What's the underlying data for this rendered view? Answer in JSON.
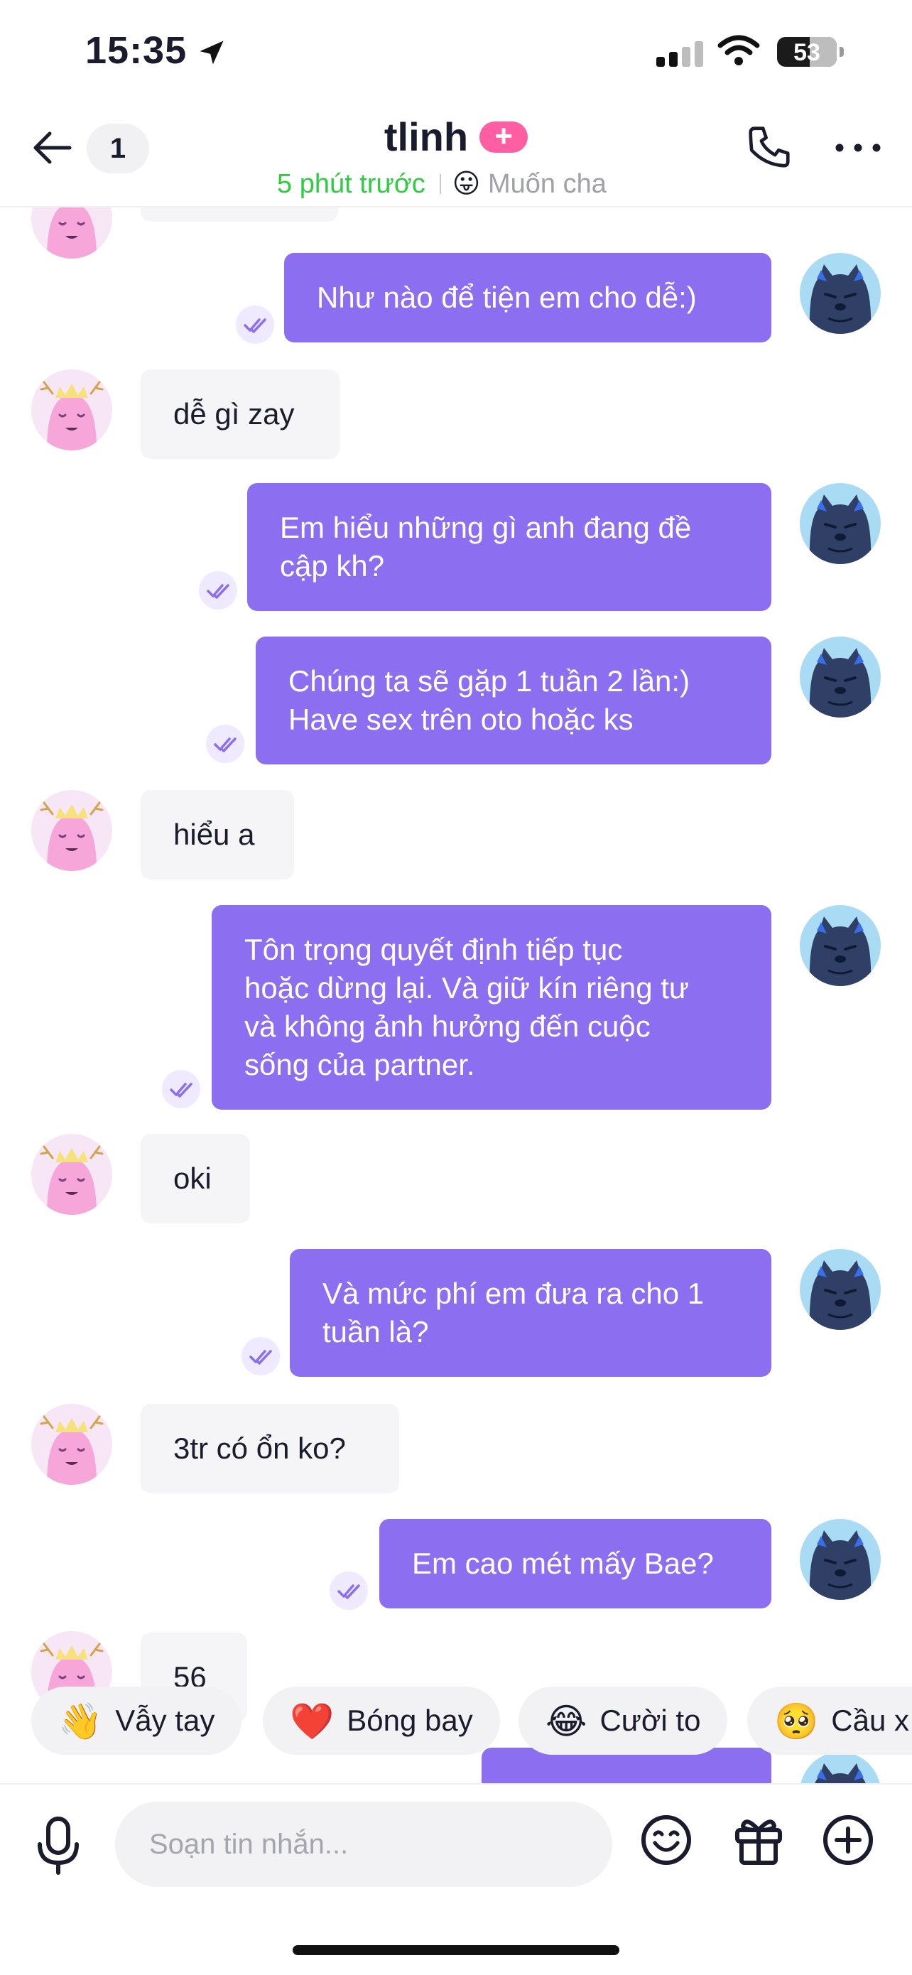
{
  "status_bar": {
    "time": "15:35",
    "battery": "53"
  },
  "header": {
    "unread_count": "1",
    "title": "tlinh",
    "plus_badge": "+",
    "last_seen": "5 phút trước",
    "mood_emoji": "😛",
    "mood_text": "Muốn cha"
  },
  "messages": [
    {
      "side": "out",
      "text": "Như nào để tiện em cho dễ:)"
    },
    {
      "side": "in",
      "text": "dễ gì zay"
    },
    {
      "side": "out",
      "lines": [
        "Em hiểu những gì anh đang đề",
        "cập kh?"
      ]
    },
    {
      "side": "out",
      "lines": [
        "Chúng ta sẽ gặp 1 tuần 2 lần:)",
        "Have sex trên oto hoặc ks"
      ]
    },
    {
      "side": "in",
      "text": "hiểu a"
    },
    {
      "side": "out",
      "lines": [
        "Tôn trọng quyết định tiếp tục",
        "hoặc dừng lại. Và giữ kín riêng tư",
        "và không ảnh hưởng đến cuộc",
        "sống của partner."
      ]
    },
    {
      "side": "in",
      "text": "oki"
    },
    {
      "side": "out",
      "lines": [
        "Và mức phí em đưa ra cho 1",
        "tuần là?"
      ]
    },
    {
      "side": "in",
      "text": "3tr có ổn ko?"
    },
    {
      "side": "out",
      "text": "Em cao mét mấy Bae?"
    },
    {
      "side": "in",
      "text": "56"
    }
  ],
  "quick_reactions": [
    {
      "emoji": "👋",
      "label": "Vẫy tay"
    },
    {
      "emoji": "❤️",
      "label": "Bóng bay"
    },
    {
      "emoji": "😂",
      "label": "Cười to"
    },
    {
      "emoji": "🥺",
      "label": "Cầu x"
    }
  ],
  "composer": {
    "placeholder": "Soạn tin nhắn..."
  },
  "colors": {
    "accent": "#8c6ff0",
    "online": "#2ecc40",
    "badge": "#ff5fa2"
  }
}
